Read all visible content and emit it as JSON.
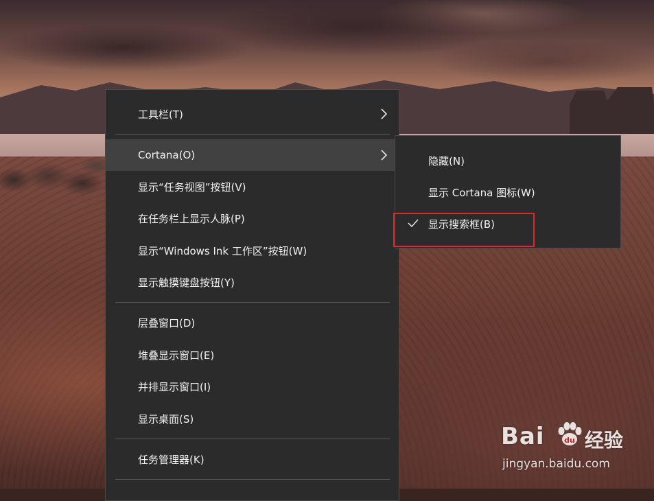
{
  "context_menu": {
    "items": [
      {
        "label": "工具栏(T)"
      },
      {
        "label": "Cortana(O)"
      },
      {
        "label": "显示“任务视图”按钮(V)"
      },
      {
        "label": "在任务栏上显示人脉(P)"
      },
      {
        "label": "显示“Windows Ink 工作区”按钮(W)"
      },
      {
        "label": "显示触摸键盘按钮(Y)"
      },
      {
        "label": "层叠窗口(D)"
      },
      {
        "label": "堆叠显示窗口(E)"
      },
      {
        "label": "并排显示窗口(I)"
      },
      {
        "label": "显示桌面(S)"
      },
      {
        "label": "任务管理器(K)"
      }
    ],
    "hovered_item": "Cortana(O)"
  },
  "cortana_submenu": {
    "items": [
      {
        "label": "隐藏(N)",
        "checked": false
      },
      {
        "label": "显示 Cortana 图标(W)",
        "checked": false
      },
      {
        "label": "显示搜索框(B)",
        "checked": true
      }
    ],
    "highlight_color": "#e0282b"
  },
  "watermark": {
    "logo": "Bai",
    "logo2": "du",
    "cn": "经验",
    "url": "jingyan.baidu.com"
  },
  "colors": {
    "menu_bg": "#2b2b2b",
    "menu_hover": "#414141",
    "menu_text": "#f2f2f2"
  }
}
